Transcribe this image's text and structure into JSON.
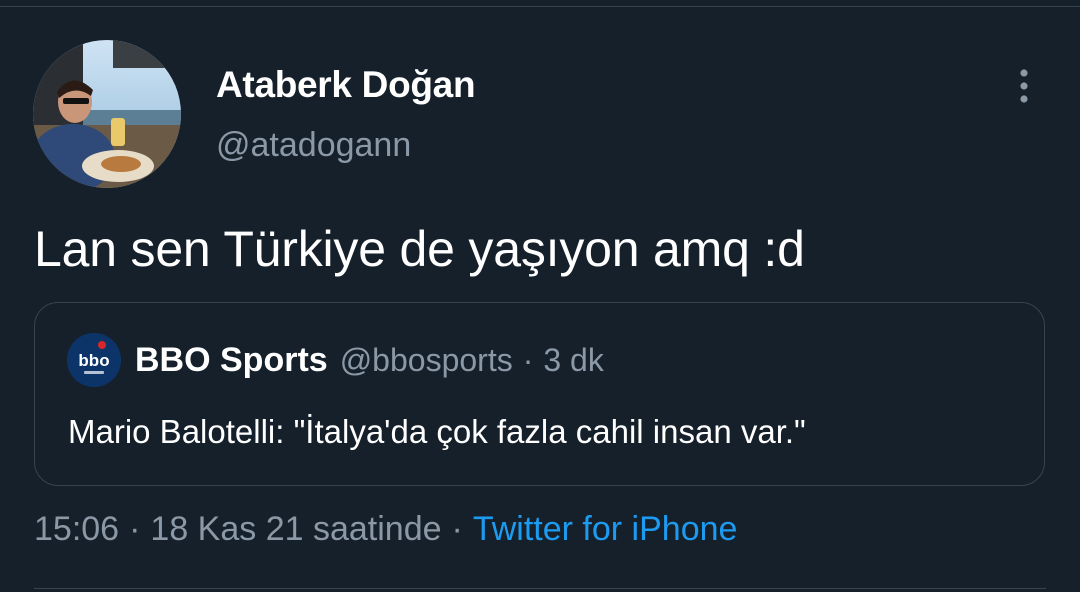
{
  "author": {
    "display_name": "Ataberk Doğan",
    "handle": "@atadogann"
  },
  "tweet": {
    "text": "Lan sen Türkiye de yaşıyon amq :d"
  },
  "quoted_tweet": {
    "display_name": "BBO Sports",
    "handle": "@bbosports",
    "separator": "·",
    "time": "3 dk",
    "text": "Mario Balotelli: \"İtalya'da çok fazla cahil insan var.\"",
    "avatar_logo_text": "bbo"
  },
  "meta": {
    "time": "15:06",
    "separator": "·",
    "date": "18 Kas 21 saatinde",
    "source": "Twitter for iPhone"
  },
  "icons": {
    "more": "more-vertical-icon"
  },
  "colors": {
    "background": "#15202b",
    "secondary_text": "#8b98a5",
    "link": "#1d9bf0",
    "border": "#38444d"
  }
}
